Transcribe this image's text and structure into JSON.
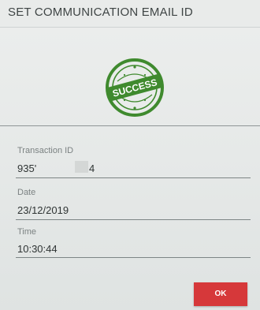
{
  "dialog": {
    "title": "SET COMMUNICATION EMAIL ID",
    "stamp_text": "SUCCESS",
    "stamp_icon": "success-stamp-icon",
    "stamp_color": "#3f8a2e"
  },
  "fields": {
    "transaction_id": {
      "label": "Transaction ID",
      "value": "935'",
      "value_suffix": "4"
    },
    "date": {
      "label": "Date",
      "value": "23/12/2019"
    },
    "time": {
      "label": "Time",
      "value": "10:30:44"
    }
  },
  "actions": {
    "ok_label": "OK",
    "ok_color": "#d6383a"
  }
}
